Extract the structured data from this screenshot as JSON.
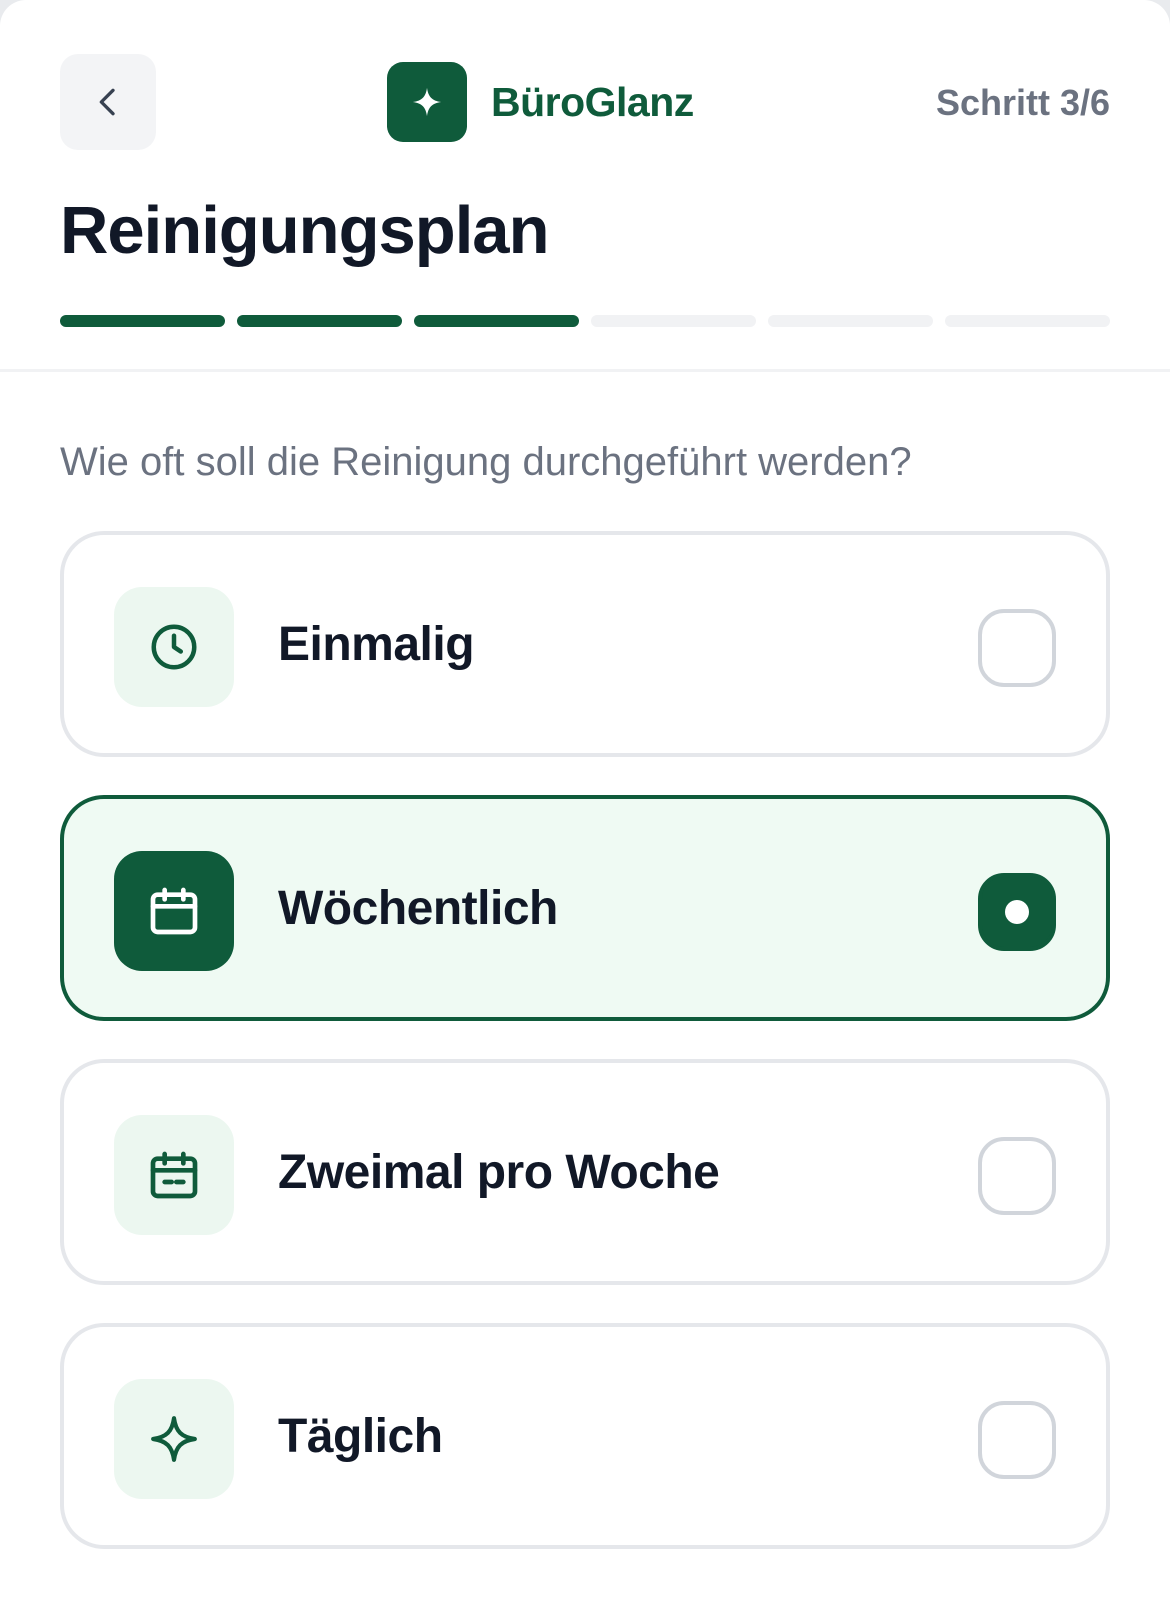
{
  "header": {
    "brand_name": "BüroGlanz",
    "step_text": "Schritt 3/6",
    "title": "Reinigungsplan",
    "progress": {
      "current_step": 3,
      "total_steps": 6
    }
  },
  "question": "Wie oft soll die Reinigung durchgeführt werden?",
  "options": [
    {
      "label": "Einmalig",
      "icon": "clock-icon",
      "selected": false
    },
    {
      "label": "Wöchentlich",
      "icon": "calendar-icon",
      "selected": true
    },
    {
      "label": "Zweimal pro Woche",
      "icon": "calendar-dashes-icon",
      "selected": false
    },
    {
      "label": "Täglich",
      "icon": "sparkle-icon",
      "selected": false
    }
  ],
  "colors": {
    "brand": "#0f5b3b",
    "selected_background": "#effaf3",
    "icon_tile": "#ecf7f0",
    "text_dark": "#111827",
    "text_muted": "#6b7280"
  }
}
